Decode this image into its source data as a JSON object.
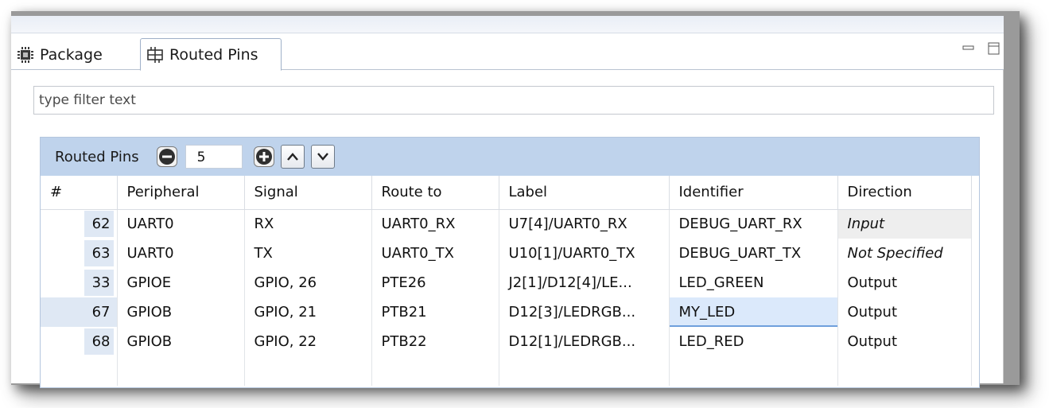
{
  "tabs": [
    {
      "label": "Package",
      "icon": "chip-icon"
    },
    {
      "label": "Routed Pins",
      "icon": "routed-pins-icon"
    }
  ],
  "filter": {
    "placeholder": "type filter text"
  },
  "panel": {
    "title": "Routed Pins",
    "count": "5"
  },
  "table": {
    "columns": [
      "#",
      "Peripheral",
      "Signal",
      "Route to",
      "Label",
      "Identifier",
      "Direction"
    ],
    "rows": [
      {
        "num": "62",
        "peripheral": "UART0",
        "signal": "RX",
        "route_to": "UART0_RX",
        "label": "U7[4]/UART0_RX",
        "identifier": "DEBUG_UART_RX",
        "direction": "Input"
      },
      {
        "num": "63",
        "peripheral": "UART0",
        "signal": "TX",
        "route_to": "UART0_TX",
        "label": "U10[1]/UART0_TX",
        "identifier": "DEBUG_UART_TX",
        "direction": "Not Specified"
      },
      {
        "num": "33",
        "peripheral": "GPIOE",
        "signal": "GPIO, 26",
        "route_to": "PTE26",
        "label": "J2[1]/D12[4]/LE...",
        "identifier": "LED_GREEN",
        "direction": "Output"
      },
      {
        "num": "67",
        "peripheral": "GPIOB",
        "signal": "GPIO, 21",
        "route_to": "PTB21",
        "label": "D12[3]/LEDRGB...",
        "identifier": "MY_LED",
        "direction": "Output"
      },
      {
        "num": "68",
        "peripheral": "GPIOB",
        "signal": "GPIO, 22",
        "route_to": "PTB22",
        "label": "D12[1]/LEDRGB...",
        "identifier": "LED_RED",
        "direction": "Output"
      }
    ]
  }
}
